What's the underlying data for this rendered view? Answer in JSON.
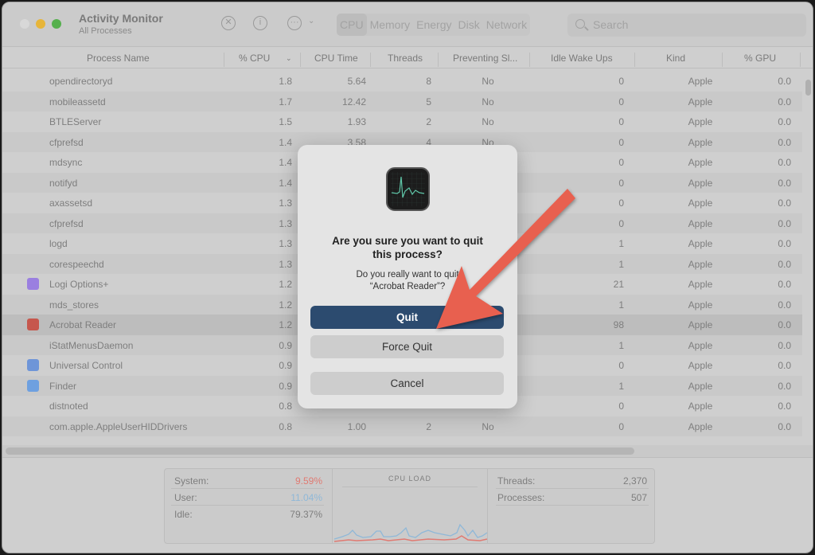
{
  "window": {
    "title": "Activity Monitor",
    "subtitle": "All Processes"
  },
  "toolbar": {
    "tabs": [
      "CPU",
      "Memory",
      "Energy",
      "Disk",
      "Network"
    ],
    "active_tab": "CPU",
    "search_placeholder": "Search",
    "icons": [
      "stop-icon",
      "info-icon",
      "more-icon"
    ]
  },
  "columns": [
    "Process Name",
    "% CPU",
    "CPU Time",
    "Threads",
    "Preventing Sl...",
    "Idle Wake Ups",
    "Kind",
    "% GPU"
  ],
  "rows": [
    [
      "opendirectoryd",
      "1.8",
      "5.64",
      "8",
      "No",
      "0",
      "Apple",
      "0.0",
      ""
    ],
    [
      "mobileassetd",
      "1.7",
      "12.42",
      "5",
      "No",
      "0",
      "Apple",
      "0.0",
      ""
    ],
    [
      "BTLEServer",
      "1.5",
      "1.93",
      "2",
      "No",
      "0",
      "Apple",
      "0.0",
      ""
    ],
    [
      "cfprefsd",
      "1.4",
      "3.58",
      "4",
      "No",
      "0",
      "Apple",
      "0.0",
      ""
    ],
    [
      "mdsync",
      "1.4",
      "",
      "",
      "",
      "0",
      "Apple",
      "0.0",
      ""
    ],
    [
      "notifyd",
      "1.4",
      "",
      "",
      "",
      "0",
      "Apple",
      "0.0",
      ""
    ],
    [
      "axassetsd",
      "1.3",
      "",
      "",
      "",
      "0",
      "Apple",
      "0.0",
      ""
    ],
    [
      "cfprefsd",
      "1.3",
      "",
      "",
      "",
      "0",
      "Apple",
      "0.0",
      ""
    ],
    [
      "logd",
      "1.3",
      "",
      "",
      "",
      "1",
      "Apple",
      "0.0",
      ""
    ],
    [
      "corespeechd",
      "1.3",
      "",
      "",
      "",
      "1",
      "Apple",
      "0.0",
      ""
    ],
    [
      "Logi Options+",
      "1.2",
      "",
      "",
      "",
      "21",
      "Apple",
      "0.0",
      "logi"
    ],
    [
      "mds_stores",
      "1.2",
      "",
      "",
      "",
      "1",
      "Apple",
      "0.0",
      ""
    ],
    [
      "Acrobat Reader",
      "1.2",
      "",
      "",
      "",
      "98",
      "Apple",
      "0.0",
      "acrobat"
    ],
    [
      "iStatMenusDaemon",
      "0.9",
      "",
      "",
      "",
      "1",
      "Apple",
      "0.0",
      ""
    ],
    [
      "Universal Control",
      "0.9",
      "",
      "",
      "",
      "0",
      "Apple",
      "0.0",
      "universal"
    ],
    [
      "Finder",
      "0.9",
      "",
      "",
      "",
      "1",
      "Apple",
      "0.0",
      "finder"
    ],
    [
      "distnoted",
      "0.8",
      "",
      "",
      "",
      "0",
      "Apple",
      "0.0",
      ""
    ],
    [
      "com.apple.AppleUserHIDDrivers",
      "0.8",
      "1.00",
      "2",
      "No",
      "0",
      "Apple",
      "0.0",
      ""
    ]
  ],
  "selected_row": 12,
  "stats": {
    "system_label": "System:",
    "system": "9.59%",
    "user_label": "User:",
    "user": "11.04%",
    "idle_label": "Idle:",
    "idle": "79.37%",
    "chart_title": "CPU LOAD",
    "threads_label": "Threads:",
    "threads": "2,370",
    "processes_label": "Processes:",
    "processes": "507",
    "system_color": "#e07a72",
    "user_color": "#8fb8d8"
  },
  "dialog": {
    "title": "Are you sure you want to quit this process?",
    "message": "Do you really want to quit “Acrobat Reader”?",
    "quit": "Quit",
    "force_quit": "Force Quit",
    "cancel": "Cancel"
  },
  "annotation": {
    "arrow_color": "#e8604f"
  }
}
